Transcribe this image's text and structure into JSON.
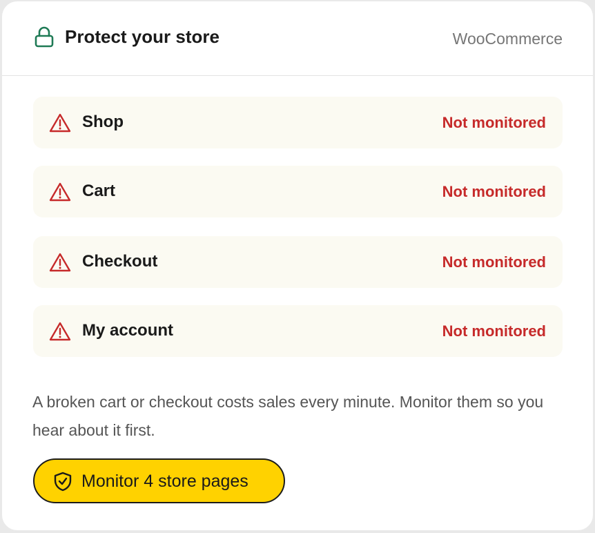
{
  "header": {
    "title": "Protect your store",
    "brand": "WooCommerce",
    "icon": "lock-icon"
  },
  "pages": [
    {
      "label": "Shop",
      "status": "Not monitored",
      "icon": "warning-icon"
    },
    {
      "label": "Cart",
      "status": "Not monitored",
      "icon": "warning-icon"
    },
    {
      "label": "Checkout",
      "status": "Not monitored",
      "icon": "warning-icon"
    },
    {
      "label": "My account",
      "status": "Not monitored",
      "icon": "warning-icon"
    }
  ],
  "description": "A broken cart or checkout costs sales every minute. Monitor them so you hear about it first.",
  "cta": {
    "label": "Monitor 4 store pages",
    "icon": "shield-check-icon"
  },
  "colors": {
    "accent_green": "#1e7a55",
    "status_red": "#c62a2a",
    "button_yellow": "#ffd200",
    "row_background": "#fbfaf2"
  }
}
